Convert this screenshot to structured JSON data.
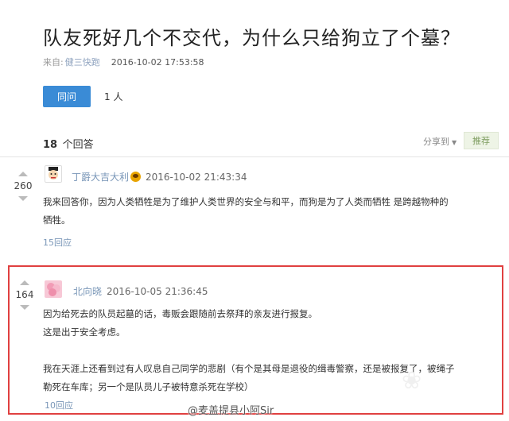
{
  "question": {
    "title": "队友死好几个不交代，为什么只给狗立了个墓？",
    "source_label": "来自:",
    "source_name": "健三快跑",
    "date": "2016-10-02 17:53:58",
    "same_question_button": "同问",
    "same_question_count": "1 人"
  },
  "answers_header": {
    "count": "18",
    "count_unit": "个回答",
    "share_label": "分享到",
    "recommend_label": "推荐"
  },
  "answers": [
    {
      "votes": "260",
      "author": "丁爵大吉大利",
      "time": "2016-10-02 21:43:34",
      "content_lines": [
        "我来回答你，因为人类牺牲是为了维护人类世界的安全与和平，而狗是为了人类而牺牲 是跨越物种的",
        "牺牲。"
      ],
      "reply_label": "15回应"
    },
    {
      "votes": "164",
      "author": "北向晓",
      "time": "2016-10-05 21:36:45",
      "content_lines": [
        "因为给死去的队员起墓的话，毒贩会跟随前去祭拜的亲友进行报复。",
        "这是出于安全考虑。",
        "",
        "我在天涯上还看到过有人叹息自己同学的悲剧（有个是其母是退役的缉毒警察，还是被报复了，被绳子",
        "勒死在车库；另一个是队员儿子被特意杀死在学校）"
      ],
      "reply_label": "10回应"
    }
  ],
  "watermark": "@麦盖提县小阿Sir",
  "colors": {
    "primary_button": "#3a8bd6",
    "link": "#7a97b8",
    "highlight_border": "#e04040"
  }
}
